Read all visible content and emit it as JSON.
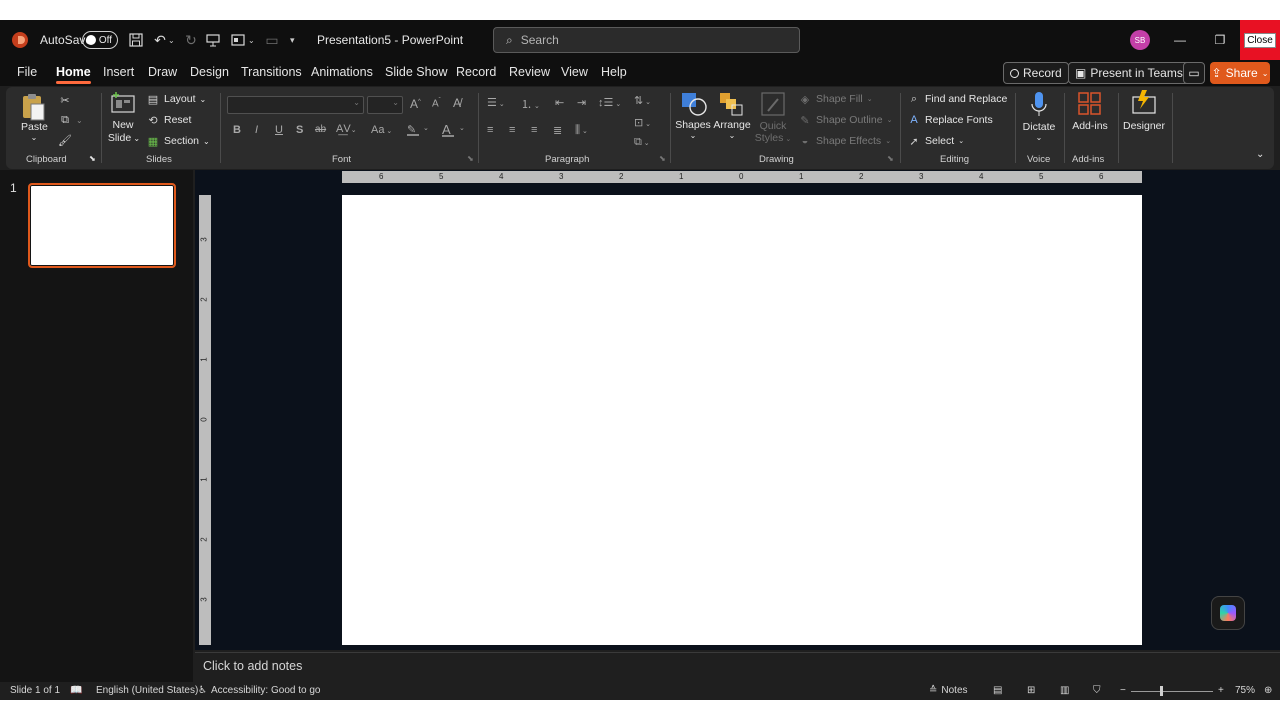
{
  "titlebar": {
    "autosave_label": "AutoSave",
    "autosave_state": "Off",
    "document_title": "Presentation5  -  PowerPoint",
    "search_placeholder": "Search",
    "user_initials": "SB",
    "close_label": "Close"
  },
  "tabs": [
    "File",
    "Home",
    "Insert",
    "Draw",
    "Design",
    "Transitions",
    "Animations",
    "Slide Show",
    "Record",
    "Review",
    "View",
    "Help"
  ],
  "active_tab": "Home",
  "tab_actions": {
    "record": "Record",
    "present": "Present in Teams",
    "share": "Share"
  },
  "ribbon": {
    "clipboard": {
      "paste": "Paste",
      "group": "Clipboard"
    },
    "slides": {
      "new_slide_1": "New",
      "new_slide_2": "Slide",
      "layout": "Layout",
      "reset": "Reset",
      "section": "Section",
      "group": "Slides"
    },
    "font": {
      "group": "Font",
      "bold": "B",
      "italic": "I",
      "underline": "U",
      "shadow": "S",
      "strike": "ab",
      "case": "Aa",
      "grow": "A",
      "shrink": "A"
    },
    "paragraph": {
      "group": "Paragraph"
    },
    "drawing": {
      "shapes": "Shapes",
      "arrange": "Arrange",
      "quick_styles_1": "Quick",
      "quick_styles_2": "Styles",
      "shape_fill": "Shape Fill",
      "shape_outline": "Shape Outline",
      "shape_effects": "Shape Effects",
      "group": "Drawing"
    },
    "editing": {
      "find_replace": "Find and Replace",
      "replace_fonts": "Replace Fonts",
      "select": "Select",
      "group": "Editing"
    },
    "voice": {
      "dictate": "Dictate",
      "group": "Voice"
    },
    "addins": {
      "addins": "Add-ins",
      "group": "Add-ins"
    },
    "designer": {
      "designer": "Designer"
    }
  },
  "slide_panel": {
    "slide_number": "1"
  },
  "rulers": {
    "horizontal": [
      "6",
      "5",
      "4",
      "3",
      "2",
      "1",
      "0",
      "1",
      "2",
      "3",
      "4",
      "5",
      "6"
    ],
    "vertical": [
      "3",
      "2",
      "1",
      "0",
      "1",
      "2",
      "3"
    ]
  },
  "notes": {
    "placeholder": "Click to add notes"
  },
  "status": {
    "slide": "Slide 1 of 1",
    "language": "English (United States)",
    "accessibility": "Accessibility: Good to go",
    "notes": "Notes",
    "zoom": "75%"
  },
  "colors": {
    "accent": "#e0591c",
    "close": "#e81123",
    "canvas_bg": "#0b111b"
  }
}
